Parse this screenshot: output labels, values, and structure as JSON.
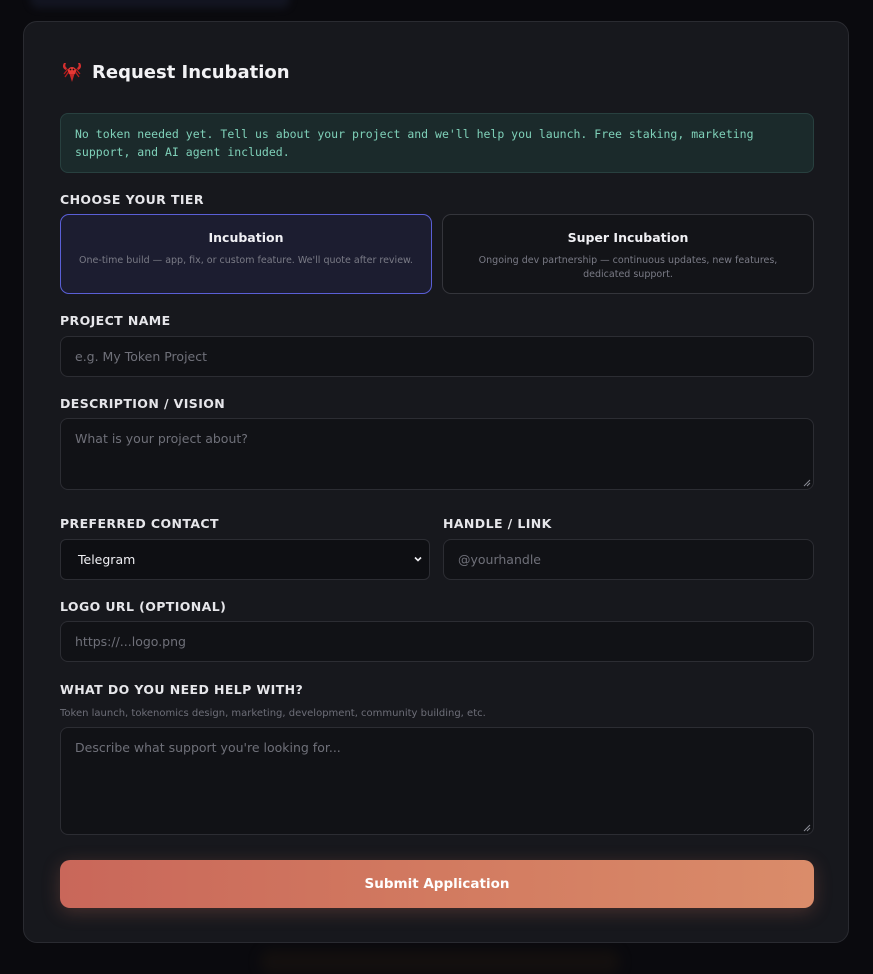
{
  "header": {
    "title": "Request Incubation",
    "logo_icon": "lobster-icon"
  },
  "info": {
    "text": "No token needed yet. Tell us about your project and we'll help you launch. Free staking, marketing support, and AI agent included."
  },
  "tier_section": {
    "label": "CHOOSE YOUR TIER",
    "options": [
      {
        "title": "Incubation",
        "description": "One-time build — app, fix, or custom feature. We'll quote after review.",
        "selected": true
      },
      {
        "title": "Super Incubation",
        "description": "Ongoing dev partnership — continuous updates, new features, dedicated support.",
        "selected": false
      }
    ]
  },
  "project_name": {
    "label": "PROJECT NAME",
    "placeholder": "e.g. My Token Project",
    "value": ""
  },
  "description": {
    "label": "DESCRIPTION / VISION",
    "placeholder": "What is your project about?",
    "value": ""
  },
  "contact": {
    "label": "PREFERRED CONTACT",
    "selected": "Telegram"
  },
  "handle": {
    "label": "HANDLE / LINK",
    "placeholder": "@yourhandle",
    "value": ""
  },
  "logo_url": {
    "label": "LOGO URL (OPTIONAL)",
    "placeholder": "https://...logo.png",
    "value": ""
  },
  "help": {
    "label": "WHAT DO YOU NEED HELP WITH?",
    "hint": "Token launch, tokenomics design, marketing, development, community building, etc.",
    "placeholder": "Describe what support you're looking for...",
    "value": ""
  },
  "submit": {
    "label": "Submit Application"
  },
  "colors": {
    "accent_selected_border": "#5a5fd6",
    "info_text": "#7fd1b9",
    "submit_start": "#c9675a",
    "submit_end": "#da8c6a"
  }
}
